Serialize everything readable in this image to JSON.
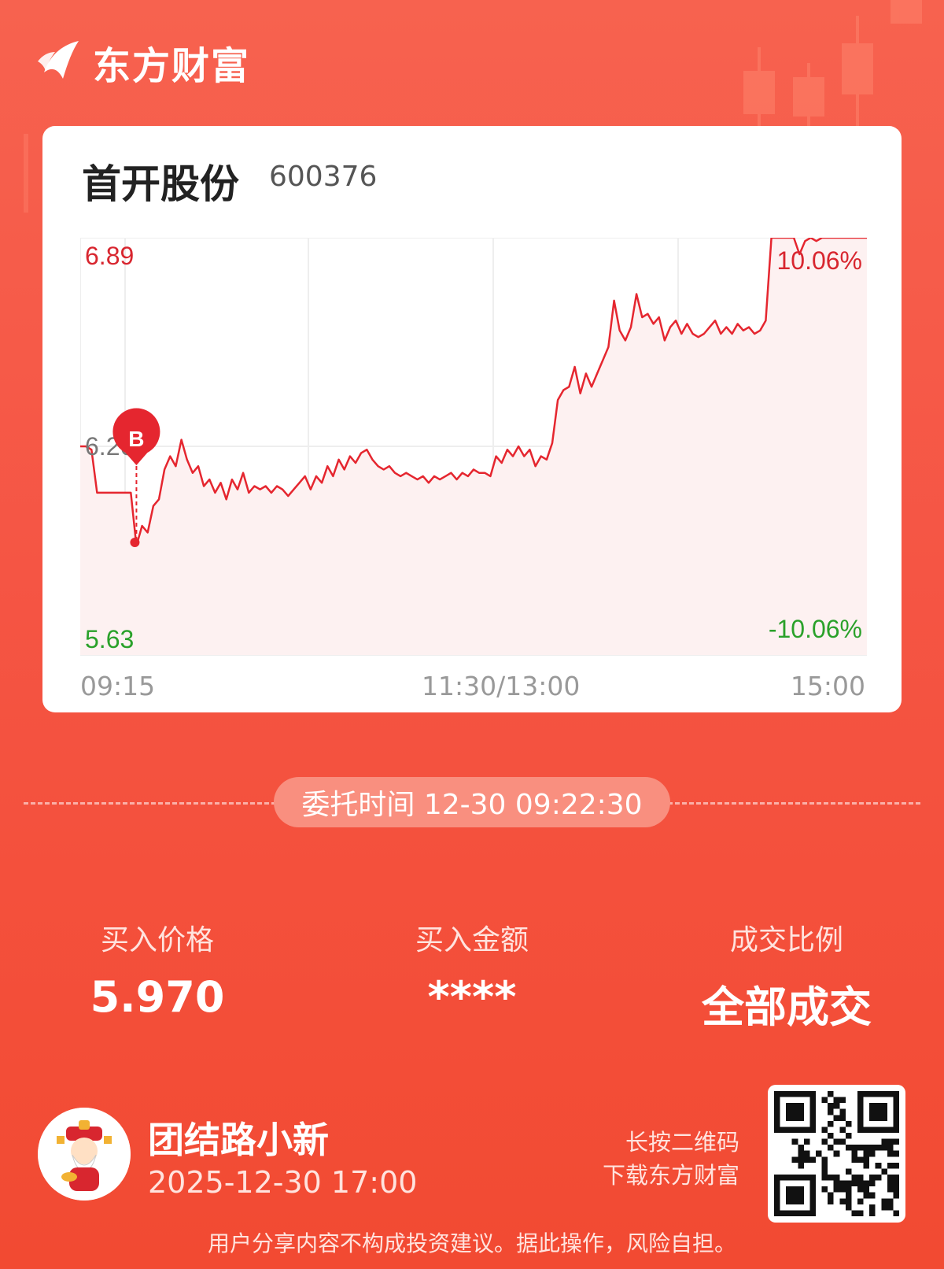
{
  "brand": {
    "name": "东方财富",
    "logo_icon": "eastmoney-logo-icon"
  },
  "stock": {
    "name": "首开股份",
    "code": "600376"
  },
  "chart_data": {
    "type": "line",
    "y_max_label": "6.89",
    "y_mid_label": "6.26",
    "y_min_label": "5.63",
    "pct_max_label": "10.06%",
    "pct_min_label": "-10.06%",
    "ylim": [
      5.63,
      6.89
    ],
    "prev_close": 6.26,
    "x_ticks": [
      "09:15",
      "11:30/13:00",
      "15:00"
    ],
    "buy_marker": {
      "label": "B",
      "time": "09:22:30",
      "price": 5.97
    },
    "price_line_color": "#e5262f",
    "series": [
      {
        "values": [
          6.26,
          6.26,
          6.25,
          6.12,
          6.12,
          6.12,
          6.12,
          6.12,
          6.12,
          6.12,
          5.96,
          6.02,
          6.0,
          6.08,
          6.1,
          6.19,
          6.23,
          6.2,
          6.28,
          6.22,
          6.18,
          6.2,
          6.14,
          6.16,
          6.12,
          6.15,
          6.1,
          6.16,
          6.13,
          6.18,
          6.12,
          6.14,
          6.13,
          6.14,
          6.12,
          6.14,
          6.13,
          6.11,
          6.13,
          6.15,
          6.17,
          6.13,
          6.17,
          6.15,
          6.2,
          6.17,
          6.22,
          6.19,
          6.23,
          6.21,
          6.24,
          6.25,
          6.22,
          6.2,
          6.19,
          6.2,
          6.18,
          6.17,
          6.18,
          6.17,
          6.16,
          6.17,
          6.15,
          6.17,
          6.16,
          6.17,
          6.18,
          6.16,
          6.18,
          6.17,
          6.19,
          6.18,
          6.18,
          6.17,
          6.23,
          6.21,
          6.25,
          6.23,
          6.26,
          6.23,
          6.25,
          6.2,
          6.23,
          6.22,
          6.27,
          6.4,
          6.43,
          6.44,
          6.5,
          6.42,
          6.48,
          6.44,
          6.48,
          6.52,
          6.56,
          6.7,
          6.61,
          6.58,
          6.62,
          6.72,
          6.65,
          6.66,
          6.63,
          6.65,
          6.58,
          6.62,
          6.64,
          6.6,
          6.63,
          6.6,
          6.59,
          6.6,
          6.62,
          6.64,
          6.6,
          6.62,
          6.6,
          6.63,
          6.61,
          6.62,
          6.6,
          6.61,
          6.64,
          6.89,
          6.89,
          6.89,
          6.89,
          6.89,
          6.84,
          6.88,
          6.89,
          6.88,
          6.89,
          6.89,
          6.89,
          6.89,
          6.89,
          6.89,
          6.89,
          6.89,
          6.89
        ]
      }
    ]
  },
  "order": {
    "label": "委托时间 12-30 09:22:30"
  },
  "stats": [
    {
      "label": "买入价格",
      "value": "5.970"
    },
    {
      "label": "买入金额",
      "value": "****"
    },
    {
      "label": "成交比例",
      "value": "全部成交"
    }
  ],
  "user": {
    "name": "团结路小新",
    "datetime": "2025-12-30 17:00"
  },
  "qr": {
    "hint_line1": "长按二维码",
    "hint_line2": "下载东方财富"
  },
  "disclaimer": "用户分享内容不构成投资建议。据此操作，风险自担。"
}
